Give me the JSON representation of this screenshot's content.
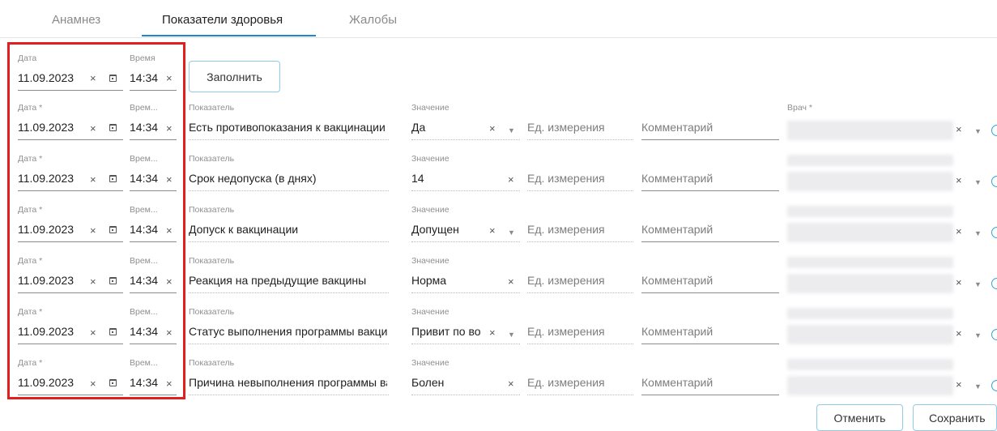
{
  "tabs": [
    {
      "label": "Анамнез",
      "active": false
    },
    {
      "label": "Показатели здоровья",
      "active": true
    },
    {
      "label": "Жалобы",
      "active": false
    }
  ],
  "header_row": {
    "date_label": "Дата",
    "date_value": "11.09.2023",
    "time_label": "Время",
    "time_value": "14:34",
    "fill_button": "Заполнить"
  },
  "labels": {
    "date": "Дата *",
    "time": "Врем...",
    "indicator": "Показатель",
    "value": "Значение",
    "unit_placeholder": "Ед. измерения",
    "comment_placeholder": "Комментарий",
    "doctor": "Врач *"
  },
  "rows": [
    {
      "date": "11.09.2023",
      "time": "14:34",
      "indicator": "Есть противопоказания к вакцинации",
      "value": "Да",
      "value_has_dropdown": true
    },
    {
      "date": "11.09.2023",
      "time": "14:34",
      "indicator": "Срок недопуска (в днях)",
      "value": "14",
      "value_has_dropdown": false
    },
    {
      "date": "11.09.2023",
      "time": "14:34",
      "indicator": "Допуск к вакцинации",
      "value": "Допущен",
      "value_has_dropdown": true
    },
    {
      "date": "11.09.2023",
      "time": "14:34",
      "indicator": "Реакция на предыдущие вакцины",
      "value": "Норма",
      "value_has_dropdown": false
    },
    {
      "date": "11.09.2023",
      "time": "14:34",
      "indicator": "Статус выполнения программы вакцинации",
      "value": "Привит по возрасту",
      "value_has_dropdown": true
    },
    {
      "date": "11.09.2023",
      "time": "14:34",
      "indicator": "Причина невыполнения программы вакцинации",
      "value": "Болен",
      "value_has_dropdown": false
    }
  ],
  "footer": {
    "cancel_button": "Отменить",
    "save_button": "Сохранить"
  },
  "colors": {
    "accent": "#1e88c8",
    "highlight": "#e31e1e",
    "button_border": "#8fcbe6"
  },
  "icons": {
    "clear": "×",
    "dropdown": "▼",
    "calendar": "calendar-icon"
  }
}
